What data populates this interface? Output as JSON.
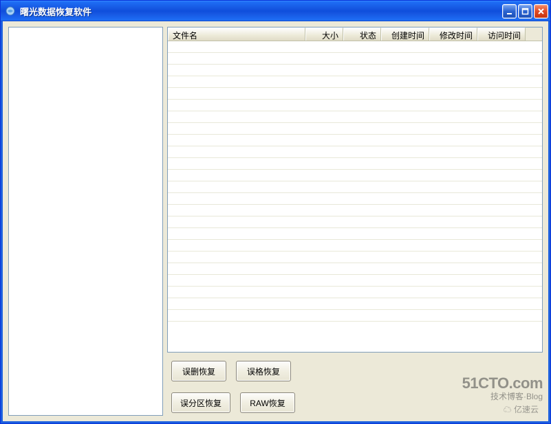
{
  "window": {
    "title": "曙光数据恢复软件"
  },
  "columns": {
    "name": "文件名",
    "size": "大小",
    "status": "状态",
    "created": "创建时间",
    "modified": "修改时间",
    "accessed": "访问时间"
  },
  "columnWidths": {
    "name": 200,
    "size": 55,
    "status": 55,
    "created": 70,
    "modified": 70,
    "accessed": 70
  },
  "buttons": {
    "recoverDeleted": "误删恢复",
    "recoverFormat": "误格恢复",
    "recoverPartition": "误分区恢复",
    "recoverRaw": "RAW恢复"
  },
  "watermark": {
    "main": "51CTO.com",
    "sub": "技术博客·Blog",
    "badge": "亿速云"
  },
  "emptyRowCount": 24
}
